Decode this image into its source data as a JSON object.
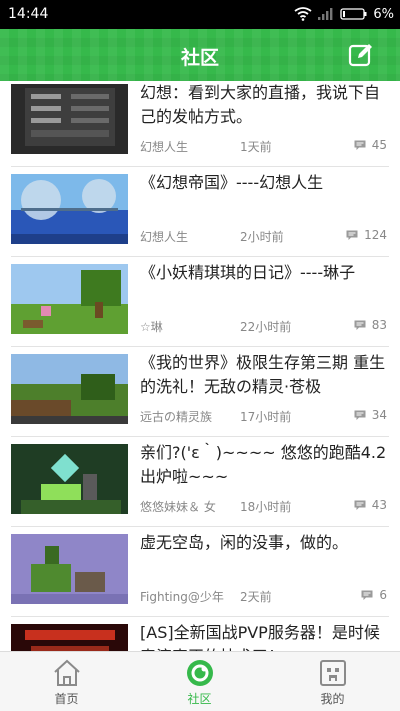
{
  "status_bar": {
    "time": "14:44",
    "battery": "6%",
    "wifi_icon": "wifi-icon",
    "signal_icon": "signal-icon",
    "battery_icon": "battery-icon"
  },
  "header": {
    "title": "社区",
    "compose_icon": "compose-icon"
  },
  "posts": [
    {
      "title": "幻想：看到大家的直播，我说下自己的发帖方式。",
      "author": "幻想人生",
      "time": "1天前",
      "comments": "45"
    },
    {
      "title": "《幻想帝国》----幻想人生",
      "author": "幻想人生",
      "time": "2小时前",
      "comments": "124"
    },
    {
      "title": "《小妖精琪琪的日记》----琳子",
      "author": "☆琳",
      "time": "22小时前",
      "comments": "83"
    },
    {
      "title": "《我的世界》极限生存第三期 重生的洗礼！无敌の精灵·苍极",
      "author": "远古の精灵族",
      "time": "17小时前",
      "comments": "34"
    },
    {
      "title": "亲们?('ε｀)~~~~ 悠悠的跑酷4.2出炉啦~~~",
      "author": "悠悠妹妹＆ 女",
      "time": "18小时前",
      "comments": "43"
    },
    {
      "title": "虚无空岛，闲的没事，做的。",
      "author": "Fighting@少年",
      "time": "2天前",
      "comments": "6"
    },
    {
      "title": "[AS]全新国战PVP服务器！是时候表演真正的技术了！",
      "author": "",
      "time": "",
      "comments": ""
    }
  ],
  "tabs": [
    {
      "label": "首页",
      "icon": "home-icon",
      "active": false
    },
    {
      "label": "社区",
      "icon": "community-icon",
      "active": true
    },
    {
      "label": "我的",
      "icon": "profile-icon",
      "active": false
    }
  ],
  "colors": {
    "accent": "#36b94b",
    "muted_text": "#888888",
    "status_bar": "#000000"
  }
}
